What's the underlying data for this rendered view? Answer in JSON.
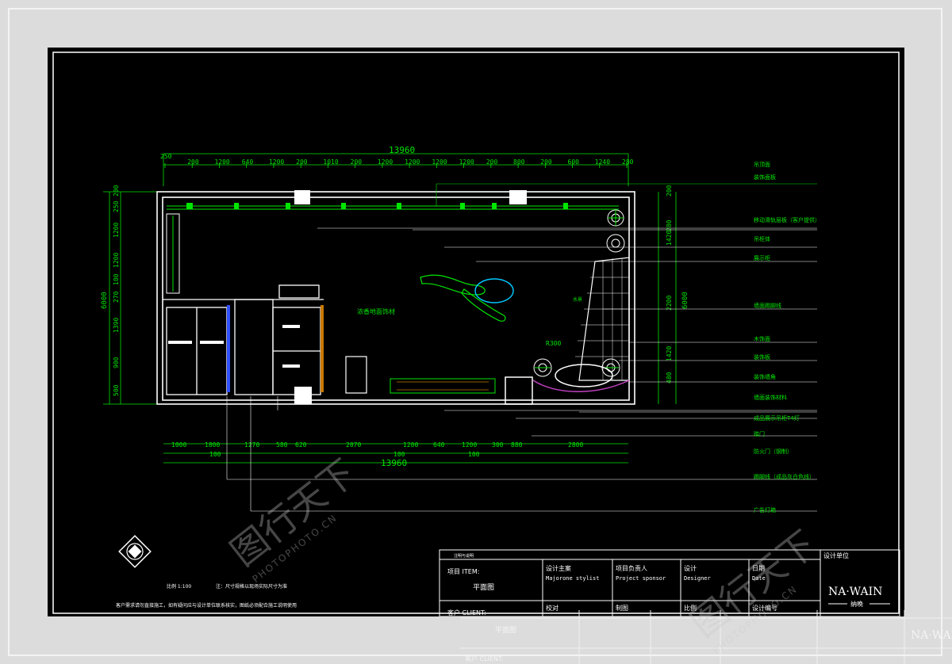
{
  "overall_dimension": "13960",
  "top_dimensions": [
    "250",
    "200",
    "1200",
    "640",
    "1200",
    "200",
    "1010",
    "200",
    "1200",
    "1200",
    "1200",
    "1200",
    "200",
    "800",
    "200",
    "600",
    "1240",
    "280"
  ],
  "bottom_dimensions": [
    "1000",
    "1800",
    "1270",
    "580",
    "620",
    "2070",
    "1200",
    "640",
    "1200",
    "300",
    "880",
    "2800"
  ],
  "bottom_small": [
    "100",
    "100",
    "100"
  ],
  "left_dimensions": [
    "6000",
    "200",
    "250",
    "1200",
    "1200",
    "100",
    "270",
    "1390",
    "900",
    "500"
  ],
  "right_dimensions": [
    "200",
    "280",
    "1420",
    "2200",
    "1420",
    "480",
    "6000"
  ],
  "room_label": "浓香地面饰材",
  "radius_label": "R300",
  "plant_label": "水景",
  "annotations": [
    "吊顶面",
    "装饰面板",
    "移动滑轨层板（客户提供）",
    "吊柜体",
    "展示柜",
    "墙面踢脚线",
    "木饰面",
    "装饰板",
    "装饰墙角",
    "墙面装饰材料",
    "成品展示吊柜T4灯",
    "踏门",
    "防火门（钢制）",
    "踢脚线（成品灰白色线）",
    "广告灯箱"
  ],
  "drawing_title_label": "项目 ITEM:",
  "drawing_title_value": "平面图",
  "client_label": "客户 CLIENT:",
  "designer_header": "设计主案",
  "designer_en": "Majorone stylist",
  "sponsor_header": "项目负责人",
  "sponsor_en": "Project sponsor",
  "design_header": "设计",
  "design_en": "Designer",
  "date_header": "日期",
  "date_en": "Date",
  "check_header": "校对",
  "draw_header": "制图",
  "scale_header": "比例",
  "number_header": "设计编号",
  "unit_header": "设计单位",
  "company_logo": "NA·WAIN",
  "company_sub": "纳晚",
  "notes_header": "注明与说明",
  "note_scale": "比例 1:100",
  "note_dim": "注：尺寸规格以现场实际尺寸为准",
  "note_line": "客户需求请勿直接施工，如有疑问应与设计单位联系核实，图纸必须配合施工说明使用",
  "watermark_text": "图行天下",
  "watermark_url": "PHOTOPHOTO.CN",
  "green": "#00e600",
  "white": "#ffffff",
  "cyan": "#00c8ff"
}
